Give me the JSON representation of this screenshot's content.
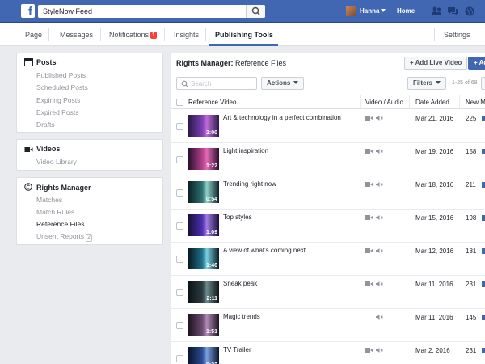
{
  "topbar": {
    "search_value": "StyleNow Feed",
    "user_name": "Hanna",
    "home_label": "Home"
  },
  "page_nav": {
    "tabs": [
      {
        "label": "Page"
      },
      {
        "label": "Messages"
      },
      {
        "label": "Notifications",
        "badge": "1"
      },
      {
        "label": "Insights"
      },
      {
        "label": "Publishing Tools",
        "active": true
      }
    ],
    "settings_label": "Settings"
  },
  "sidebar": {
    "posts": {
      "title": "Posts",
      "items": [
        "Published Posts",
        "Scheduled Posts",
        "Expiring Posts",
        "Expired Posts",
        "Drafts"
      ]
    },
    "videos": {
      "title": "Videos",
      "items": [
        "Video Library"
      ]
    },
    "rights_manager": {
      "title": "Rights Manager",
      "items": [
        "Matches",
        "Match Rules",
        "Reference Files",
        "Unsent Reports"
      ],
      "unsent_count": "2",
      "active_item": "Reference Files"
    }
  },
  "main": {
    "title_bold": "Rights Manager:",
    "title_rest": "Reference Files",
    "add_live_video_label": "+ Add Live Video",
    "add_label": "+ Ad",
    "search_placeholder": "Search",
    "actions_label": "Actions",
    "filters_label": "Filters",
    "page_count": "1-25 of 68",
    "columns": {
      "reference_video": "Reference Video",
      "video_audio": "Video / Audio",
      "date_added": "Date Added",
      "new_matches": "New M"
    },
    "rows": [
      {
        "title": "Art & technology in a perfect combination",
        "duration": "2:00",
        "date": "Mar 21, 2016",
        "matches": "225",
        "has_video": true,
        "thumb": "purple"
      },
      {
        "title": "Light inspiration",
        "duration": "1:22",
        "date": "Mar 19, 2016",
        "matches": "158",
        "has_video": true,
        "thumb": "pink"
      },
      {
        "title": "Trending right now",
        "duration": "0:54",
        "date": "Mar 18, 2016",
        "matches": "211",
        "has_video": true,
        "thumb": "teal"
      },
      {
        "title": "Top styles",
        "duration": "1:09",
        "date": "Mar 15, 2016",
        "matches": "198",
        "has_video": true,
        "thumb": "violet"
      },
      {
        "title": "A view of what's coming next",
        "duration": "1:46",
        "date": "Mar 12, 2016",
        "matches": "181",
        "has_video": true,
        "thumb": "cyan"
      },
      {
        "title": "Sneak peak",
        "duration": "2:11",
        "date": "Mar 11, 2016",
        "matches": "231",
        "has_video": true,
        "thumb": "dark"
      },
      {
        "title": "Magic trends",
        "duration": "1:51",
        "date": "Mar 11, 2016",
        "matches": "145",
        "has_video": false,
        "thumb": "mauve"
      },
      {
        "title": "TV Trailer",
        "duration": "0:32",
        "date": "Mar 2, 2016",
        "matches": "231",
        "has_video": true,
        "thumb": "blue"
      }
    ]
  },
  "colors": {
    "brand_blue": "#4267b2",
    "badge_red": "#fa3e3e"
  },
  "icons": [
    "facebook-logo-icon",
    "search-icon",
    "friends-icon",
    "messages-icon",
    "globe-icon",
    "calendar-icon",
    "video-camera-icon",
    "copyright-icon",
    "video-icon",
    "audio-icon"
  ]
}
